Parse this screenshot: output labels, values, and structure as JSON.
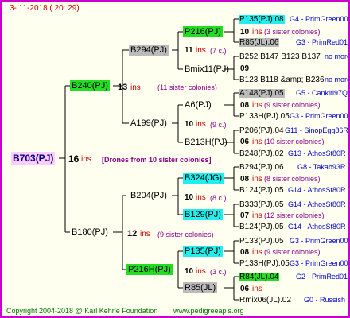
{
  "date": "3- 11-2018 ( 20: 29)",
  "root": {
    "id": "B703(PJ)",
    "ins": "16",
    "ins_word": "ins",
    "note": "[Drones from 10 sister colonies]"
  },
  "gen1": [
    {
      "id": "B240(PJ)",
      "ins": "13",
      "ins_word": "ins",
      "note": "(11 sister colonies)"
    },
    {
      "id": "B180(PJ)",
      "ins": "12",
      "ins_word": "ins",
      "note": "(9 sister colonies)"
    }
  ],
  "gen2": [
    {
      "id": "B294(PJ)",
      "ins": "11",
      "ins_word": "ins",
      "note": "(7 c.)"
    },
    {
      "id": "A199(PJ)",
      "ins": "10",
      "ins_word": "ins",
      "note": "(9 c.)"
    },
    {
      "id": "B204(PJ)",
      "ins": "10",
      "ins_word": "ins",
      "note": "(8 c.)"
    },
    {
      "id": "P216H(PJ)",
      "ins": "10",
      "ins_word": "ins",
      "note": "(3 c.)"
    }
  ],
  "gen3": [
    {
      "id": "P216(PJ)"
    },
    {
      "id": "Bmix11(PJ)"
    },
    {
      "id": "A6(PJ)"
    },
    {
      "id": "B213H(PJ)"
    },
    {
      "id": "B324(JG)"
    },
    {
      "id": "B129(PJ)"
    },
    {
      "id": "P135(PJ)"
    },
    {
      "id": "R85(JL)"
    }
  ],
  "gen4": [
    {
      "top": "P135(PJ).08",
      "top_info": "G4 - PrimGreen00",
      "ins": "10",
      "ins_word": "ins",
      "note": "(3 sister colonies)",
      "bot": "R85(JL).06",
      "bot_info": "G3 - PrimRed01"
    },
    {
      "top": "B252 B147 B123 B137",
      "top_info": "no more",
      "ins": "09",
      "ins_word": "",
      "note": "",
      "bot": "B123 B118 &amp; B236",
      "bot_info": "no more"
    },
    {
      "top": "A148(PJ).05",
      "top_info": "G5 - Cankiri97Q",
      "ins": "08",
      "ins_word": "ins",
      "note": "(9 sister colonies)",
      "bot": "P133H(PJ).05",
      "bot_info": "G3 - PrimGreen00"
    },
    {
      "top": "P206(PJ).04",
      "top_info": "G11 - SinopEgg86R",
      "ins": "06",
      "ins_word": "ins",
      "note": "(10 sister colonies)",
      "bot": "B248(PJ).02",
      "bot_info": "G13 - AthosSt80R"
    },
    {
      "top": "B294(PJ).06",
      "top_info": "G8 - Takab93R",
      "ins": "08",
      "ins_word": "ins",
      "note": "(8 sister colonies)",
      "bot": "B124(PJ).05",
      "bot_info": "G14 - AthosSt80R"
    },
    {
      "top": "B333(PJ).05",
      "top_info": "G14 - AthosSt80R",
      "ins": "07",
      "ins_word": "ins",
      "note": "(12 sister colonies)",
      "bot": "B124(PJ).05",
      "bot_info": "G14 - AthosSt80R"
    },
    {
      "top": "P133(PJ).05",
      "top_info": "G3 - PrimGreen00",
      "ins": "08",
      "ins_word": "ins",
      "note": "(9 sister colonies)",
      "bot": "P133H(PJ).05",
      "bot_info": "G3 - PrimGreen00"
    },
    {
      "top": "R84(JL).04",
      "top_info": "G2 - PrimRed01",
      "ins": "06",
      "ins_word": "ins",
      "note": "",
      "bot": "Rmix06(JL).02",
      "bot_info": "G0 - Russish"
    }
  ],
  "footer": {
    "copyright": "Copyright 2004-2018 @ Karl Kehrle Foundation",
    "site": "www.pedigreeapis.org"
  }
}
